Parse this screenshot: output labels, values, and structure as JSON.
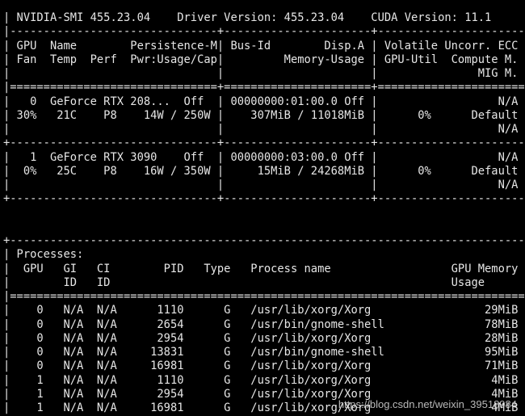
{
  "terminal": {
    "lines": [
      "| NVIDIA-SMI 455.23.04    Driver Version: 455.23.04    CUDA Version: 11.1     |",
      "|-------------------------------+----------------------+----------------------+",
      "| GPU  Name        Persistence-M| Bus-Id        Disp.A | Volatile Uncorr. ECC |",
      "| Fan  Temp  Perf  Pwr:Usage/Cap|         Memory-Usage | GPU-Util  Compute M. |",
      "|                               |                      |               MIG M. |",
      "|===============================+======================+======================|",
      "|   0  GeForce RTX 208...  Off  | 00000000:01:00.0 Off |                  N/A |",
      "| 30%   21C    P8    14W / 250W |    307MiB / 11018MiB |      0%      Default |",
      "|                               |                      |                  N/A |",
      "+-------------------------------+----------------------+----------------------+",
      "|   1  GeForce RTX 3090    Off  | 00000000:03:00.0 Off |                  N/A |",
      "|  0%   25C    P8    16W / 350W |     15MiB / 24268MiB |      0%      Default |",
      "|                               |                      |                  N/A |",
      "+-------------------------------+----------------------+----------------------+",
      "",
      "",
      "+-----------------------------------------------------------------------------+",
      "| Processes:                                                                  |",
      "|  GPU   GI   CI        PID   Type   Process name                  GPU Memory |",
      "|        ID   ID                                                   Usage      |",
      "|=============================================================================|",
      "|    0   N/A  N/A      1110      G   /usr/lib/xorg/Xorg                 29MiB |",
      "|    0   N/A  N/A      2654      G   /usr/bin/gnome-shell               78MiB |",
      "|    0   N/A  N/A      2954      G   /usr/lib/xorg/Xorg                 28MiB |",
      "|    0   N/A  N/A     13831      G   /usr/bin/gnome-shell               95MiB |",
      "|    0   N/A  N/A     16981      G   /usr/lib/xorg/Xorg                 71MiB |",
      "|    1   N/A  N/A      1110      G   /usr/lib/xorg/Xorg                  4MiB |",
      "|    1   N/A  N/A      2954      G   /usr/lib/xorg/Xorg                  4MiB |",
      "|    1   N/A  N/A     16981      G   /usr/lib/xorg/Xorg                  4MiB |",
      "+-----------------------------------------------------------------------------+"
    ],
    "watermark": "https://blog.csdn.net/weixin_39518984",
    "colors": {
      "background": "#000000",
      "foreground": "#e6e6e6"
    }
  }
}
